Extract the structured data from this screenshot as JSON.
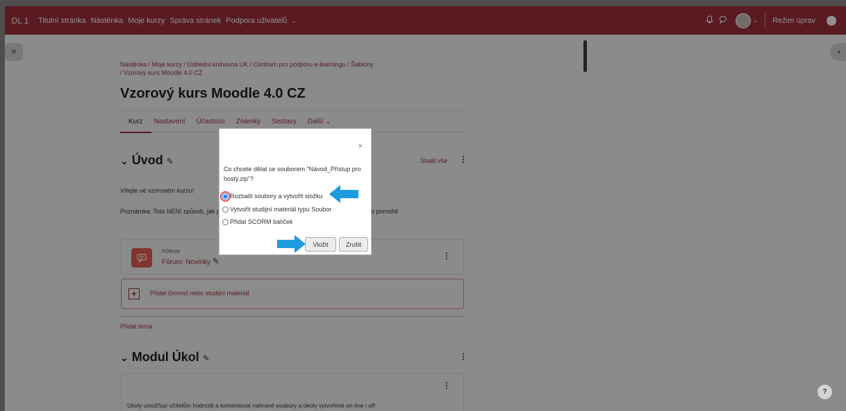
{
  "navbar": {
    "brand": "DL 1",
    "links": [
      "Titulní stránka",
      "Nástěnka",
      "Moje kurzy",
      "Správa stránek",
      "Podpora uživatelů"
    ],
    "support_caret": "⌄",
    "edit_mode_label": "Režim úprav"
  },
  "breadcrumb": {
    "line1": "Nástěnka  /  Moje kurzy  /  Ústřední knihovna UK  /  Centrum pro podporu e-learningu  /  Šablony",
    "line2": "/  Vzorový kurs Moodle 4.0 CZ"
  },
  "course": {
    "title": "Vzorový kurs Moodle 4.0 CZ",
    "tabs": [
      "Kurz",
      "Nastavení",
      "Účastníci",
      "Známky",
      "Sestavy",
      "Další"
    ]
  },
  "section_intro": {
    "title": "Úvod",
    "collapse_all": "Sbalit vše",
    "welcome": "Vítejte ve vzorovém kurzu!",
    "note": "Poznámka: Toto NENÍ způsob, jak                                                                                                          podle typu činnosti zde uvádíme jen proto, abychom vám pomohli"
  },
  "forum": {
    "type": "FÓRUM",
    "name": "Fórum: Novinky"
  },
  "add_activity": {
    "label": "Přidat činnost nebo studijní materiál"
  },
  "add_topic": "Přidat téma",
  "section_assign": {
    "title": "Modul Úkol",
    "description": "Úkoly umožňují učitelům hodnotit a komentovat nahrané soubory a úkoly vytvořené on-line i off-line"
  },
  "dialog": {
    "question": "Co chcete dělat se souborem \"Návod_Přístup pro hosty.zip\"?",
    "options": [
      "Rozbalit soubory a vytvořit složku",
      "Vytvořit studijní materiál typu Soubor",
      "Přidat SCORM balíček"
    ],
    "selected_option": "Rozbalit soubory a vytvořit složku",
    "insert_label": "Vložit",
    "cancel_label": "Zrušit",
    "close_symbol": "×"
  },
  "help_label": "?",
  "colors": {
    "brand": "#9d2f3b",
    "annotation_arrow": "#1e9be0",
    "forum_icon": "#e35d4f"
  },
  "icons": {
    "notifications": "bell-icon",
    "messages": "chat-icon",
    "drawer_left": "list-icon",
    "drawer_right": "chevron-left-icon",
    "help": "question-icon"
  }
}
